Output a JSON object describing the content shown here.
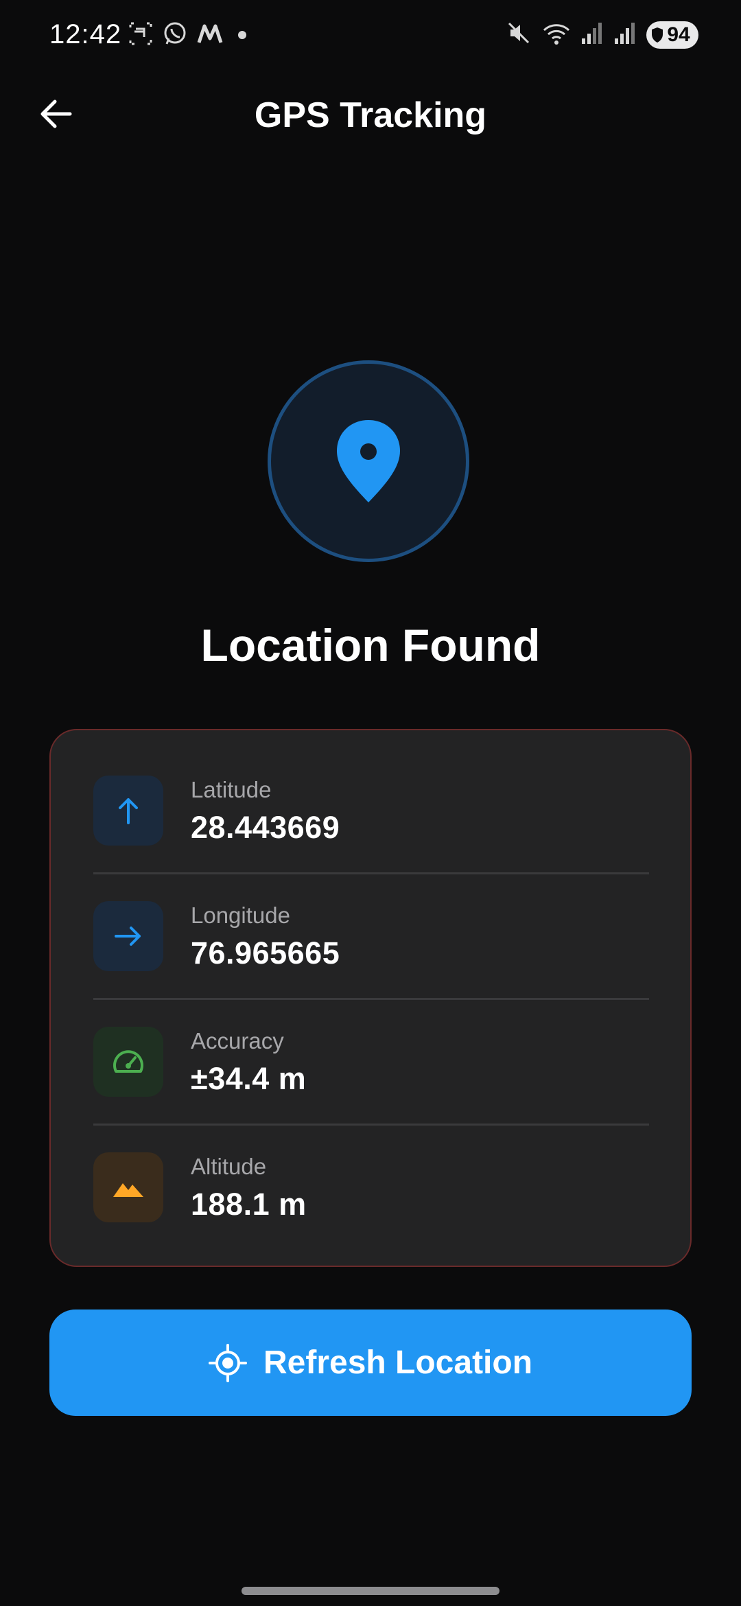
{
  "status_bar": {
    "time": "12:42",
    "battery": "94",
    "left_icons": [
      "screenshot-icon",
      "whatsapp-icon",
      "m-app-icon",
      "dot-icon"
    ],
    "right_icons": [
      "mute-icon",
      "wifi-icon",
      "signal-icon",
      "signal-icon",
      "battery-icon"
    ]
  },
  "app_bar": {
    "title": "GPS Tracking",
    "back_icon": "arrow-back-icon"
  },
  "status": {
    "title": "Location Found",
    "icon": "location-pin-icon"
  },
  "info": {
    "rows": [
      {
        "label": "Latitude",
        "value": "28.443669",
        "icon": "arrow-up-icon",
        "color": "#2196f3",
        "bg": "#1b2a3d"
      },
      {
        "label": "Longitude",
        "value": "76.965665",
        "icon": "arrow-right-icon",
        "color": "#2196f3",
        "bg": "#1b2a3d"
      },
      {
        "label": "Accuracy",
        "value": "±34.4 m",
        "icon": "speedometer-icon",
        "color": "#4caf50",
        "bg": "#1f3022"
      },
      {
        "label": "Altitude",
        "value": "188.1 m",
        "icon": "terrain-icon",
        "color": "#ffa726",
        "bg": "#3a2c1c"
      }
    ]
  },
  "refresh_button": {
    "label": "Refresh Location",
    "icon": "gps-crosshair-icon"
  },
  "colors": {
    "accent": "#2196f3",
    "background": "#0b0b0c",
    "card": "#232324",
    "card_border": "#6a2a2a"
  }
}
